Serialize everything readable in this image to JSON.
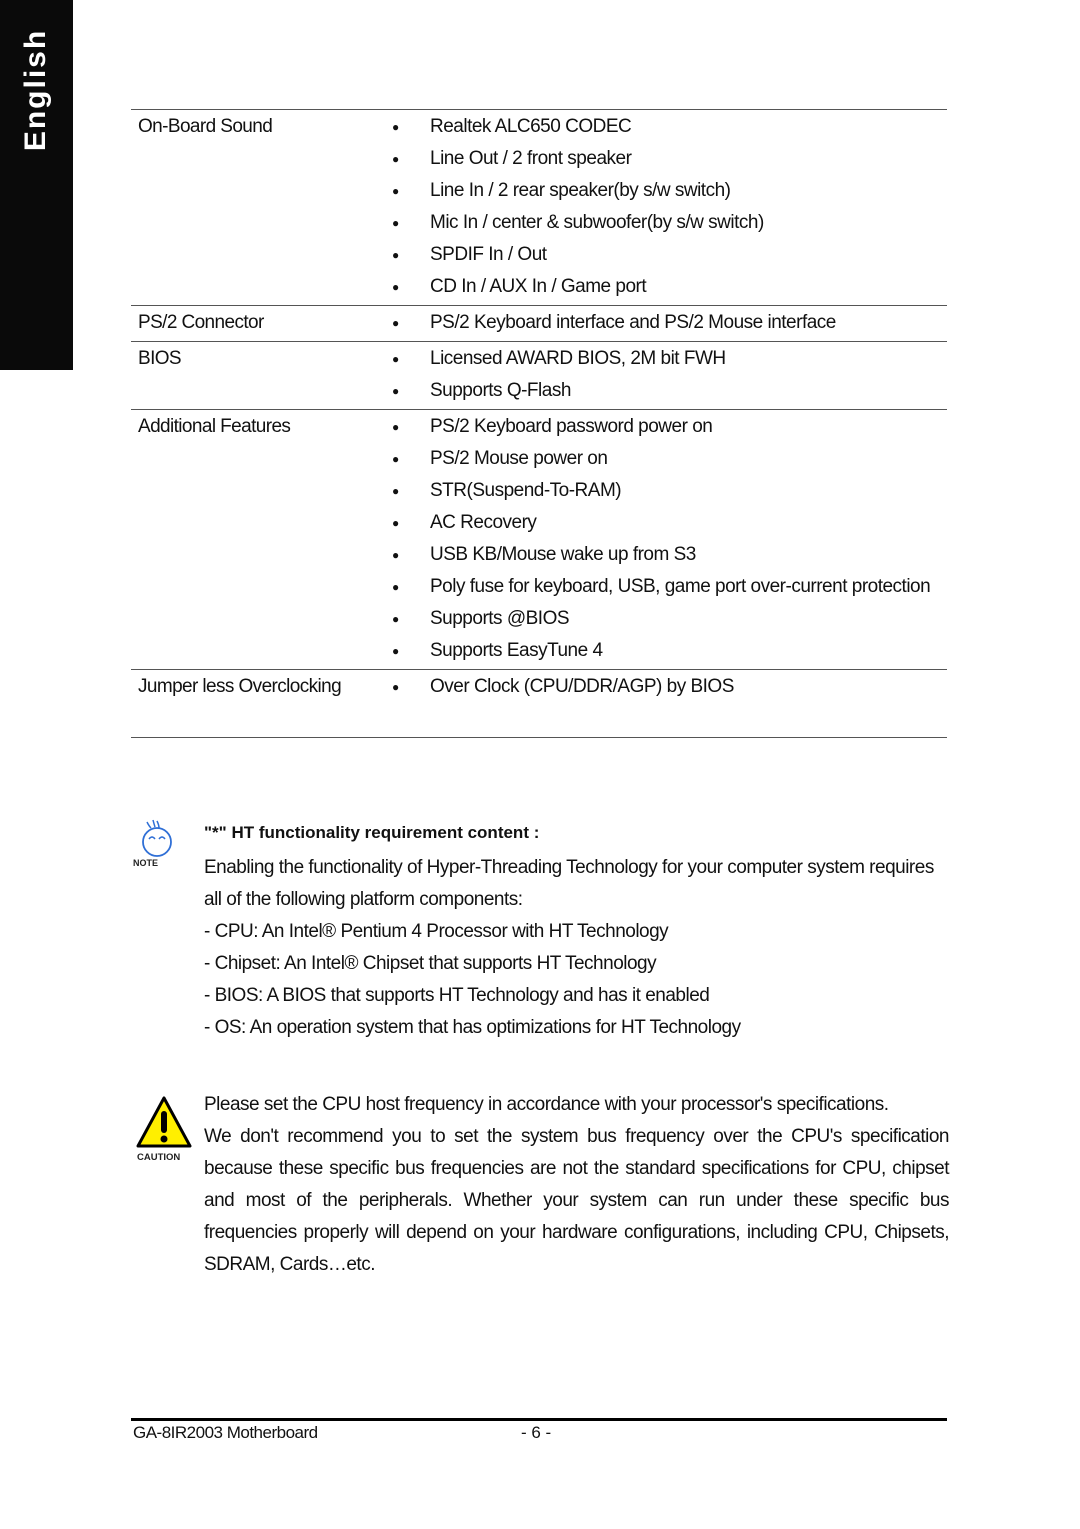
{
  "side_tab": {
    "label": "English"
  },
  "spec_table": {
    "rows": [
      {
        "label": "On-Board Sound",
        "items": [
          "Realtek ALC650 CODEC",
          "Line Out / 2 front speaker",
          "Line In / 2 rear speaker(by s/w switch)",
          "Mic In / center & subwoofer(by s/w switch)",
          "SPDIF In / Out",
          "CD In / AUX In / Game port"
        ]
      },
      {
        "label": "PS/2 Connector",
        "items": [
          "PS/2 Keyboard interface and PS/2 Mouse interface"
        ]
      },
      {
        "label": "BIOS",
        "items": [
          "Licensed AWARD BIOS, 2M bit FWH",
          "Supports Q-Flash"
        ]
      },
      {
        "label": "Additional Features",
        "items": [
          "PS/2 Keyboard password power on",
          "PS/2 Mouse power on",
          "STR(Suspend-To-RAM)",
          "AC Recovery",
          "USB KB/Mouse wake up from S3",
          "Poly fuse for keyboard, USB, game port over-current protection",
          "Supports @BIOS",
          "Supports EasyTune 4"
        ]
      },
      {
        "label": "Jumper less Overclocking",
        "items": [
          "Over Clock (CPU/DDR/AGP) by BIOS"
        ]
      }
    ]
  },
  "note": {
    "icon_label": "NOTE",
    "title": "\"*\" HT functionality requirement content :",
    "intro": "Enabling the functionality of Hyper-Threading Technology for your computer system requires all of the following platform components:",
    "lines": [
      "- CPU: An Intel® Pentium 4 Processor with HT Technology",
      "- Chipset: An Intel® Chipset that supports HT Technology",
      "- BIOS: A BIOS that supports HT Technology and has it enabled",
      "- OS: An operation system that has optimizations for HT Technology"
    ]
  },
  "caution": {
    "icon_label": "CAUTION",
    "line1": "Please set the CPU host frequency in accordance with your processor's specifications.",
    "text": "We don't recommend you to set the system bus frequency over the CPU's specification because these specific bus frequencies are not the standard specifications for CPU, chipset and most of the peripherals. Whether your system can run under these specific bus frequencies properly will depend on your hardware configurations, including CPU, Chipsets, SDRAM, Cards…etc."
  },
  "footer": {
    "product": "GA-8IR2003 Motherboard",
    "page": "- 6 -"
  }
}
